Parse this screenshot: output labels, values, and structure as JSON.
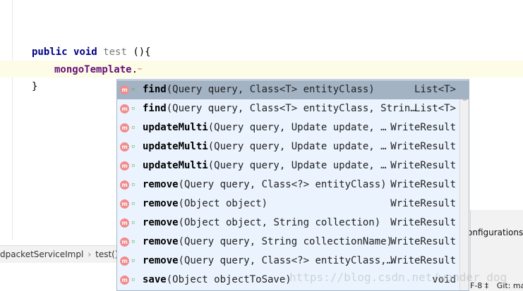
{
  "editor": {
    "method_decl": {
      "keyword_public": "public",
      "keyword_void": "void",
      "method_name": "test",
      "signature_rest": " (){"
    },
    "caret_line": {
      "field": "mongoTemplate",
      "dot": "."
    },
    "closing_brace": "}"
  },
  "breadcrumb": {
    "class_name": "dpacketServiceImpl",
    "separator": "›",
    "method": "test()"
  },
  "right_panel": {
    "configurations_label": "onfigurations"
  },
  "status_bar": {
    "encoding": "F-8 ‡",
    "git": "Git: ma"
  },
  "completion_popup": {
    "items": [
      {
        "name": "find",
        "params": "(Query query, Class<T> entityClass)",
        "return_type": "List<T>",
        "selected": true
      },
      {
        "name": "find",
        "params": "(Query query, Class<T> entityClass, Strin…",
        "return_type": "List<T>"
      },
      {
        "name": "updateMulti",
        "params": "(Query query, Update update, …",
        "return_type": "WriteResult"
      },
      {
        "name": "updateMulti",
        "params": "(Query query, Update update, …",
        "return_type": "WriteResult"
      },
      {
        "name": "updateMulti",
        "params": "(Query query, Update update, …",
        "return_type": "WriteResult"
      },
      {
        "name": "remove",
        "params": "(Query query, Class<?> entityClass)",
        "return_type": "WriteResult"
      },
      {
        "name": "remove",
        "params": "(Object object)",
        "return_type": "WriteResult"
      },
      {
        "name": "remove",
        "params": "(Object object, String collection)",
        "return_type": "WriteResult"
      },
      {
        "name": "remove",
        "params": "(Query query, String collectionName)",
        "return_type": "WriteResult"
      },
      {
        "name": "remove",
        "params": "(Query query, Class<?> entityClass,…",
        "return_type": "WriteResult"
      },
      {
        "name": "save",
        "params": "(Object objectToSave)",
        "return_type": "void"
      }
    ],
    "item_icon_letter": "m",
    "item_icon": "method-icon",
    "visibility_icon": "public-visibility-icon",
    "icon_color": "#f28c8c"
  },
  "watermark": "https://blog.csdn.net/wonder_dog"
}
